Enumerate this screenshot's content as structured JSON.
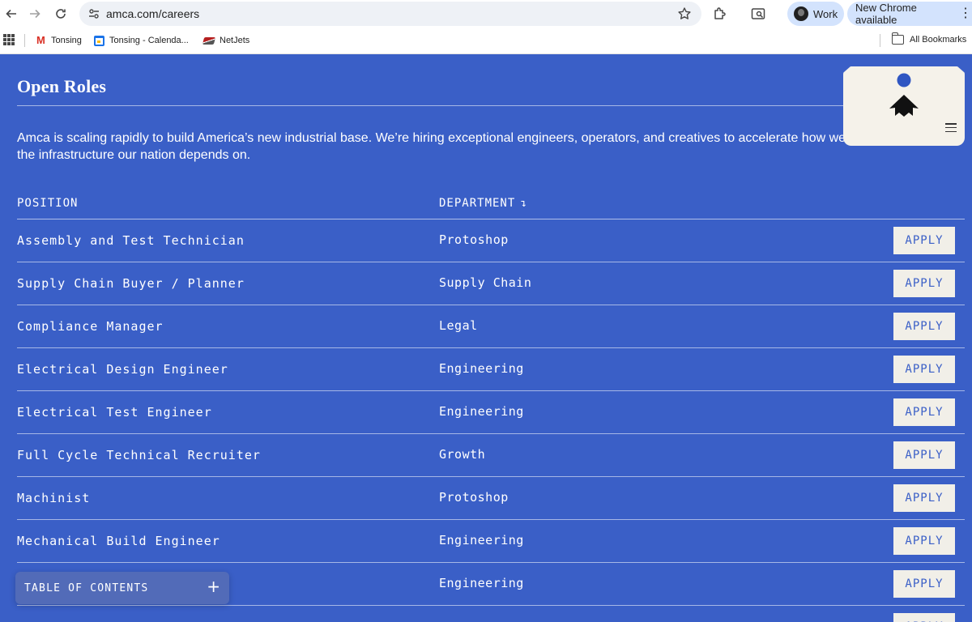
{
  "browser": {
    "url": "amca.com/careers",
    "profile_label": "Work",
    "update_label": "New Chrome available",
    "bookmarks": [
      {
        "label": "Tonsing",
        "icon": "gmail-icon"
      },
      {
        "label": "Tonsing - Calenda...",
        "icon": "calendar-icon"
      },
      {
        "label": "NetJets",
        "icon": "netjets-icon"
      }
    ],
    "all_bookmarks_label": "All Bookmarks"
  },
  "page": {
    "title": "Open Roles",
    "intro": "Amca is scaling rapidly to build America’s new industrial base. We’re hiring exceptional engineers, operators, and creatives to accelerate how we\nthe infrastructure our nation depends on.",
    "columns": {
      "position": "POSITION",
      "department": "DEPARTMENT",
      "sort_glyph": "↴"
    },
    "apply_label": "APPLY",
    "roles": [
      {
        "position": "Assembly and Test Technician",
        "department": "Protoshop"
      },
      {
        "position": "Supply Chain Buyer / Planner",
        "department": "Supply Chain"
      },
      {
        "position": "Compliance Manager",
        "department": "Legal"
      },
      {
        "position": "Electrical Design Engineer",
        "department": "Engineering"
      },
      {
        "position": "Electrical Test Engineer",
        "department": "Engineering"
      },
      {
        "position": "Full Cycle Technical Recruiter",
        "department": "Growth"
      },
      {
        "position": "Machinist",
        "department": "Protoshop"
      },
      {
        "position": "Mechanical Build Engineer",
        "department": "Engineering"
      },
      {
        "position": "",
        "department": "Engineering"
      },
      {
        "position": "",
        "department": ""
      }
    ],
    "toc_label": "TABLE OF CONTENTS",
    "toc_icon": "plus-icon"
  },
  "colors": {
    "page_background": "#3a5fc7",
    "apply_background": "#f1efe8",
    "logo_card": "#f5f2ea"
  }
}
